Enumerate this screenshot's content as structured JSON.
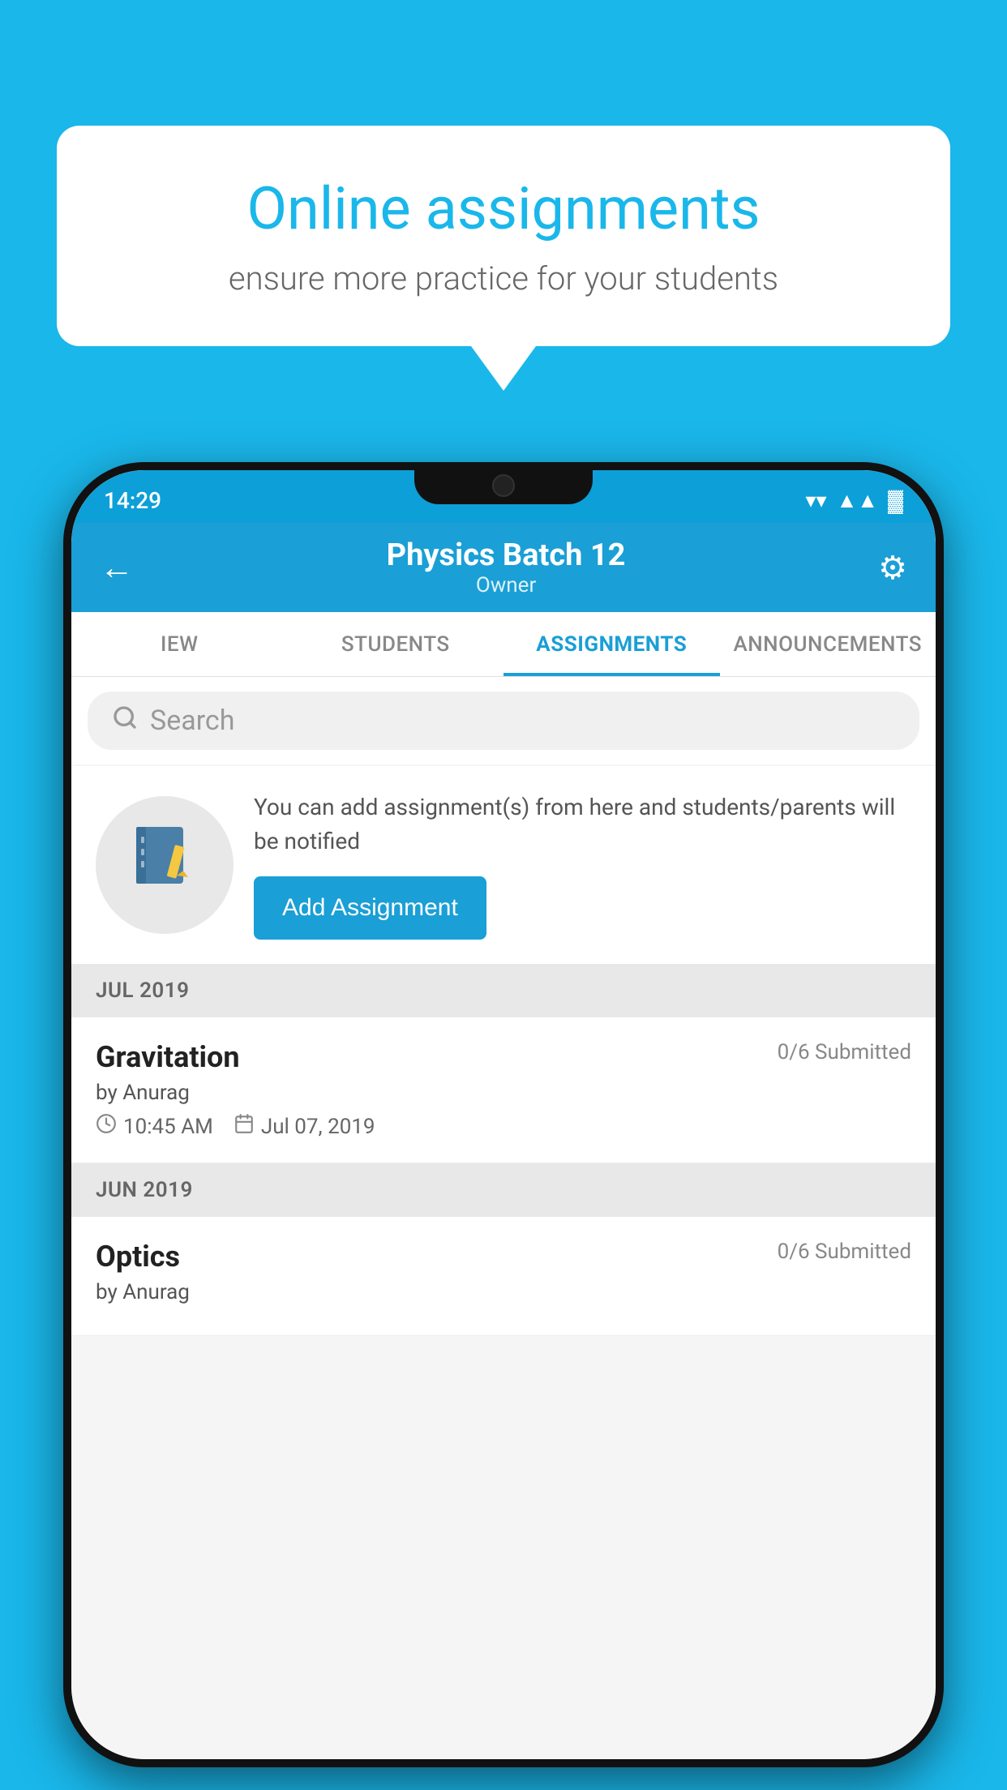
{
  "background_color": "#1ab7ea",
  "speech_bubble": {
    "title": "Online assignments",
    "subtitle": "ensure more practice for your students"
  },
  "status_bar": {
    "time": "14:29",
    "wifi": "▼",
    "signal": "▲",
    "battery": "▓"
  },
  "header": {
    "title": "Physics Batch 12",
    "subtitle": "Owner",
    "back_label": "←",
    "settings_label": "⚙"
  },
  "tabs": [
    {
      "label": "IEW",
      "active": false
    },
    {
      "label": "STUDENTS",
      "active": false
    },
    {
      "label": "ASSIGNMENTS",
      "active": true
    },
    {
      "label": "ANNOUNCEMENTS",
      "active": false
    }
  ],
  "search": {
    "placeholder": "Search"
  },
  "promo_card": {
    "text": "You can add assignment(s) from here and students/parents will be notified",
    "button_label": "Add Assignment",
    "icon": "📓"
  },
  "sections": [
    {
      "month": "JUL 2019",
      "assignments": [
        {
          "name": "Gravitation",
          "submitted": "0/6 Submitted",
          "by": "by Anurag",
          "time": "10:45 AM",
          "date": "Jul 07, 2019"
        }
      ]
    },
    {
      "month": "JUN 2019",
      "assignments": [
        {
          "name": "Optics",
          "submitted": "0/6 Submitted",
          "by": "by Anurag",
          "time": "",
          "date": ""
        }
      ]
    }
  ]
}
